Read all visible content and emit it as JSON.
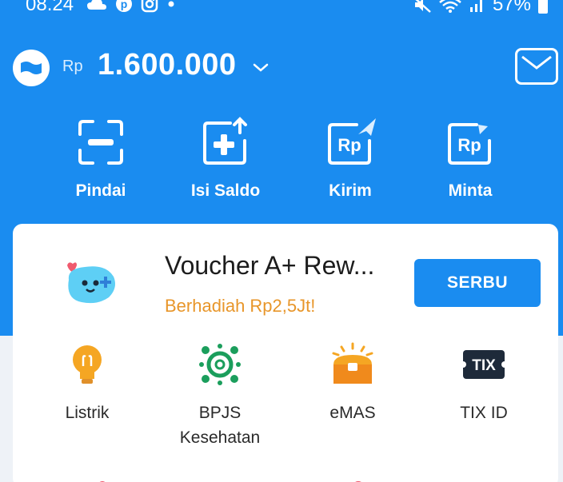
{
  "status_bar": {
    "time": "08.24",
    "battery": "57%"
  },
  "header": {
    "currency": "Rp",
    "balance": "1.600.000"
  },
  "actions": [
    {
      "label": "Pindai",
      "icon": "scan-icon"
    },
    {
      "label": "Isi Saldo",
      "icon": "top-up-icon"
    },
    {
      "label": "Kirim",
      "icon": "send-money-icon"
    },
    {
      "label": "Minta",
      "icon": "request-money-icon"
    }
  ],
  "promo": {
    "title": "Voucher A+ Rew...",
    "subtitle": "Berhadiah Rp2,5Jt!",
    "button_label": "SERBU"
  },
  "services": [
    {
      "label": "Listrik",
      "icon": "lightbulb-icon"
    },
    {
      "label": "BPJS Kesehatan",
      "icon": "bpjs-icon"
    },
    {
      "label": "eMAS",
      "icon": "gold-chest-icon"
    },
    {
      "label": "TIX ID",
      "icon": "tix-icon"
    }
  ],
  "tix_icon_text": "TIX",
  "colors": {
    "primary_blue": "#1a8cf0",
    "accent_orange": "#e8962a"
  }
}
